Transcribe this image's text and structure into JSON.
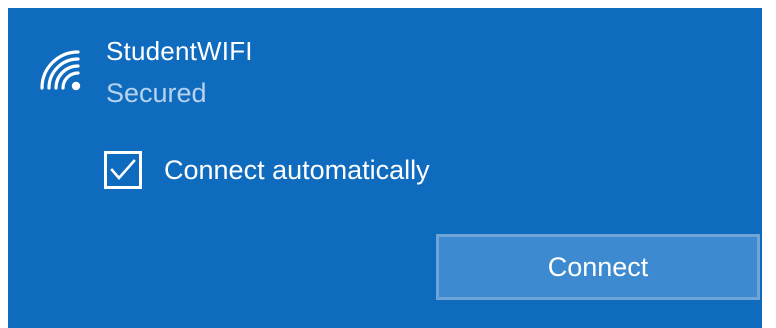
{
  "network": {
    "name": "StudentWIFI",
    "status": "Secured",
    "icon": "wifi-secured-icon"
  },
  "options": {
    "connect_automatically_label": "Connect automatically",
    "connect_automatically_checked": true
  },
  "actions": {
    "connect_label": "Connect"
  },
  "colors": {
    "panel_bg": "#0f6bbd",
    "status_text": "#b6d2ee",
    "button_bg": "#3d8ad0",
    "button_border": "#6fa4d6",
    "text": "#ffffff"
  }
}
